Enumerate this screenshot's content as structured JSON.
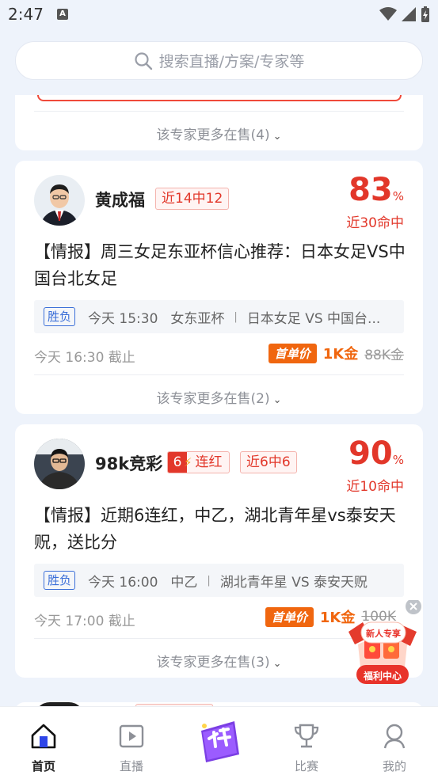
{
  "status_bar": {
    "time": "2:47",
    "a_badge": "A"
  },
  "search": {
    "placeholder": "搜索直播/方案/专家等"
  },
  "top_card": {
    "more_label": "该专家更多在售(4)"
  },
  "cards": [
    {
      "expert_name": "黄成福",
      "record_tag": "近14中12",
      "hit_rate": "83",
      "hit_rate_unit": "%",
      "hit_rate_label": "近30命中",
      "headline": "【情报】周三女足东亚杯信心推荐：日本女足VS中国台北女足",
      "match_type": "胜负",
      "match_time": "今天 15:30",
      "league": "女东亚杯",
      "teams": "日本女足 VS 中国台...",
      "deadline": "今天 16:30 截止",
      "first_price_badge": "首单价",
      "price": "1K金",
      "original_price": "88K金",
      "more_label": "该专家更多在售(2)"
    },
    {
      "expert_name": "98k竞彩",
      "streak_count": "6",
      "streak_label": "连红",
      "record_tag": "近6中6",
      "hit_rate": "90",
      "hit_rate_unit": "%",
      "hit_rate_label": "近10命中",
      "headline": "【情报】近期6连红，中乙，湖北青年星vs泰安天贶，送比分",
      "match_type": "胜负",
      "match_time": "今天 16:00",
      "league": "中乙",
      "teams": "湖北青年星 VS 泰安天贶",
      "deadline": "今天 17:00 截止",
      "first_price_badge": "首单价",
      "price": "1K金",
      "original_price": "100K",
      "more_label": "该专家更多在售(3)"
    }
  ],
  "promo": {
    "line1": "新人专享",
    "line2": "福利中心"
  },
  "tabbar": {
    "items": [
      {
        "label": "首页",
        "active": true
      },
      {
        "label": "直播",
        "active": false
      },
      {
        "label": "",
        "active": false
      },
      {
        "label": "比赛",
        "active": false
      },
      {
        "label": "我的",
        "active": false
      }
    ]
  },
  "colors": {
    "accent_red": "#e2372a",
    "price_orange": "#f0660f",
    "match_blue": "#3b6fd8",
    "background": "#eef3fb"
  }
}
